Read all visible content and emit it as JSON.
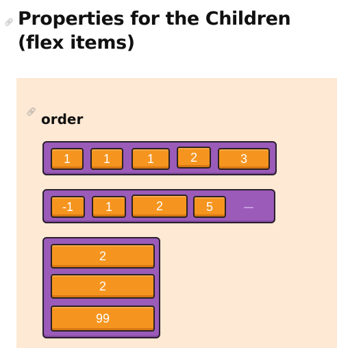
{
  "heading": {
    "title": "Properties for the Children\n(flex items)",
    "link_icon": "link-icon"
  },
  "demo": {
    "section_title": "order",
    "link_icon": "link-icon",
    "colors": {
      "panel_bg": "#fde9d4",
      "container": "#9a5bb9",
      "item": "#f5951f",
      "outline": "#2a1f2e"
    },
    "row1": [
      "1",
      "1",
      "1",
      "2",
      "3"
    ],
    "row2": [
      "-1",
      "1",
      "2",
      "5"
    ],
    "column": [
      "2",
      "2",
      "99"
    ]
  }
}
